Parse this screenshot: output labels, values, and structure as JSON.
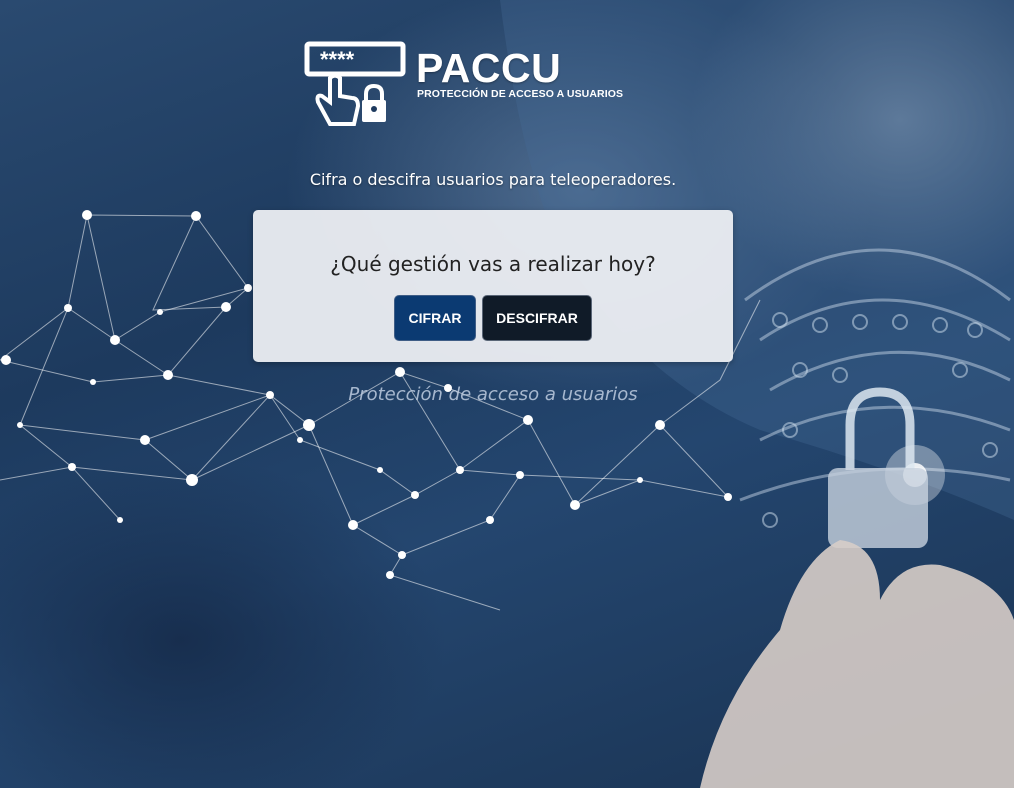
{
  "brand": {
    "name": "PACCU",
    "subtitle": "PROTECCIÓN DE ACCESO A USUARIOS",
    "icon": "password-hand-lock-icon",
    "icon_text": "****"
  },
  "tagline": "Cifra o descifra usuarios para teleoperadores.",
  "panel": {
    "question": "¿Qué gestión vas a realizar hoy?",
    "buttons": {
      "cifrar": "CIFRAR",
      "descifrar": "DESCIFRAR"
    }
  },
  "footer": "Protección de acceso a usuarios",
  "colors": {
    "background": "#1d3a5e",
    "panel": "#eceef2",
    "cifrar_button": "#0b3a72",
    "descifrar_button": "#101b28",
    "text_light": "#ffffff"
  }
}
